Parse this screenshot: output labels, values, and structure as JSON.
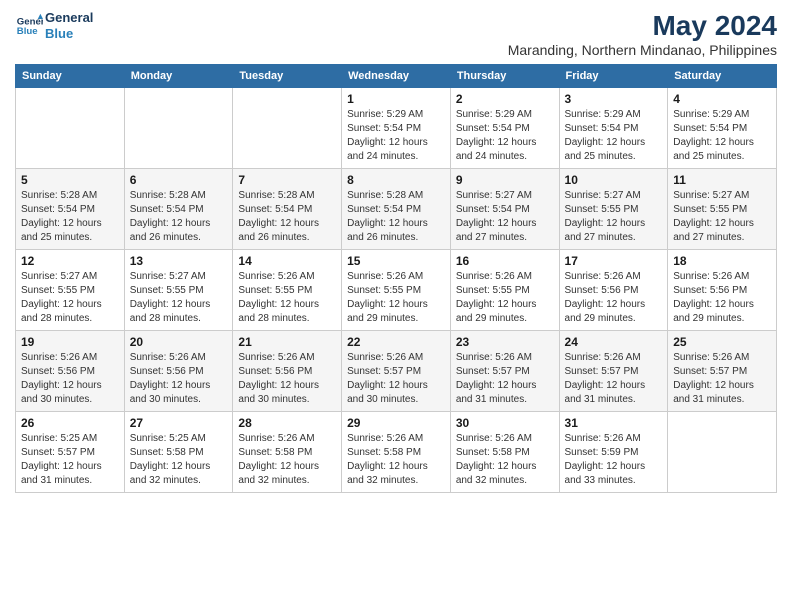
{
  "header": {
    "logo_line1": "General",
    "logo_line2": "Blue",
    "title": "May 2024",
    "subtitle": "Maranding, Northern Mindanao, Philippines"
  },
  "days_of_week": [
    "Sunday",
    "Monday",
    "Tuesday",
    "Wednesday",
    "Thursday",
    "Friday",
    "Saturday"
  ],
  "weeks": [
    [
      {
        "day": "",
        "info": ""
      },
      {
        "day": "",
        "info": ""
      },
      {
        "day": "",
        "info": ""
      },
      {
        "day": "1",
        "info": "Sunrise: 5:29 AM\nSunset: 5:54 PM\nDaylight: 12 hours\nand 24 minutes."
      },
      {
        "day": "2",
        "info": "Sunrise: 5:29 AM\nSunset: 5:54 PM\nDaylight: 12 hours\nand 24 minutes."
      },
      {
        "day": "3",
        "info": "Sunrise: 5:29 AM\nSunset: 5:54 PM\nDaylight: 12 hours\nand 25 minutes."
      },
      {
        "day": "4",
        "info": "Sunrise: 5:29 AM\nSunset: 5:54 PM\nDaylight: 12 hours\nand 25 minutes."
      }
    ],
    [
      {
        "day": "5",
        "info": "Sunrise: 5:28 AM\nSunset: 5:54 PM\nDaylight: 12 hours\nand 25 minutes."
      },
      {
        "day": "6",
        "info": "Sunrise: 5:28 AM\nSunset: 5:54 PM\nDaylight: 12 hours\nand 26 minutes."
      },
      {
        "day": "7",
        "info": "Sunrise: 5:28 AM\nSunset: 5:54 PM\nDaylight: 12 hours\nand 26 minutes."
      },
      {
        "day": "8",
        "info": "Sunrise: 5:28 AM\nSunset: 5:54 PM\nDaylight: 12 hours\nand 26 minutes."
      },
      {
        "day": "9",
        "info": "Sunrise: 5:27 AM\nSunset: 5:54 PM\nDaylight: 12 hours\nand 27 minutes."
      },
      {
        "day": "10",
        "info": "Sunrise: 5:27 AM\nSunset: 5:55 PM\nDaylight: 12 hours\nand 27 minutes."
      },
      {
        "day": "11",
        "info": "Sunrise: 5:27 AM\nSunset: 5:55 PM\nDaylight: 12 hours\nand 27 minutes."
      }
    ],
    [
      {
        "day": "12",
        "info": "Sunrise: 5:27 AM\nSunset: 5:55 PM\nDaylight: 12 hours\nand 28 minutes."
      },
      {
        "day": "13",
        "info": "Sunrise: 5:27 AM\nSunset: 5:55 PM\nDaylight: 12 hours\nand 28 minutes."
      },
      {
        "day": "14",
        "info": "Sunrise: 5:26 AM\nSunset: 5:55 PM\nDaylight: 12 hours\nand 28 minutes."
      },
      {
        "day": "15",
        "info": "Sunrise: 5:26 AM\nSunset: 5:55 PM\nDaylight: 12 hours\nand 29 minutes."
      },
      {
        "day": "16",
        "info": "Sunrise: 5:26 AM\nSunset: 5:55 PM\nDaylight: 12 hours\nand 29 minutes."
      },
      {
        "day": "17",
        "info": "Sunrise: 5:26 AM\nSunset: 5:56 PM\nDaylight: 12 hours\nand 29 minutes."
      },
      {
        "day": "18",
        "info": "Sunrise: 5:26 AM\nSunset: 5:56 PM\nDaylight: 12 hours\nand 29 minutes."
      }
    ],
    [
      {
        "day": "19",
        "info": "Sunrise: 5:26 AM\nSunset: 5:56 PM\nDaylight: 12 hours\nand 30 minutes."
      },
      {
        "day": "20",
        "info": "Sunrise: 5:26 AM\nSunset: 5:56 PM\nDaylight: 12 hours\nand 30 minutes."
      },
      {
        "day": "21",
        "info": "Sunrise: 5:26 AM\nSunset: 5:56 PM\nDaylight: 12 hours\nand 30 minutes."
      },
      {
        "day": "22",
        "info": "Sunrise: 5:26 AM\nSunset: 5:57 PM\nDaylight: 12 hours\nand 30 minutes."
      },
      {
        "day": "23",
        "info": "Sunrise: 5:26 AM\nSunset: 5:57 PM\nDaylight: 12 hours\nand 31 minutes."
      },
      {
        "day": "24",
        "info": "Sunrise: 5:26 AM\nSunset: 5:57 PM\nDaylight: 12 hours\nand 31 minutes."
      },
      {
        "day": "25",
        "info": "Sunrise: 5:26 AM\nSunset: 5:57 PM\nDaylight: 12 hours\nand 31 minutes."
      }
    ],
    [
      {
        "day": "26",
        "info": "Sunrise: 5:25 AM\nSunset: 5:57 PM\nDaylight: 12 hours\nand 31 minutes."
      },
      {
        "day": "27",
        "info": "Sunrise: 5:25 AM\nSunset: 5:58 PM\nDaylight: 12 hours\nand 32 minutes."
      },
      {
        "day": "28",
        "info": "Sunrise: 5:26 AM\nSunset: 5:58 PM\nDaylight: 12 hours\nand 32 minutes."
      },
      {
        "day": "29",
        "info": "Sunrise: 5:26 AM\nSunset: 5:58 PM\nDaylight: 12 hours\nand 32 minutes."
      },
      {
        "day": "30",
        "info": "Sunrise: 5:26 AM\nSunset: 5:58 PM\nDaylight: 12 hours\nand 32 minutes."
      },
      {
        "day": "31",
        "info": "Sunrise: 5:26 AM\nSunset: 5:59 PM\nDaylight: 12 hours\nand 33 minutes."
      },
      {
        "day": "",
        "info": ""
      }
    ]
  ]
}
